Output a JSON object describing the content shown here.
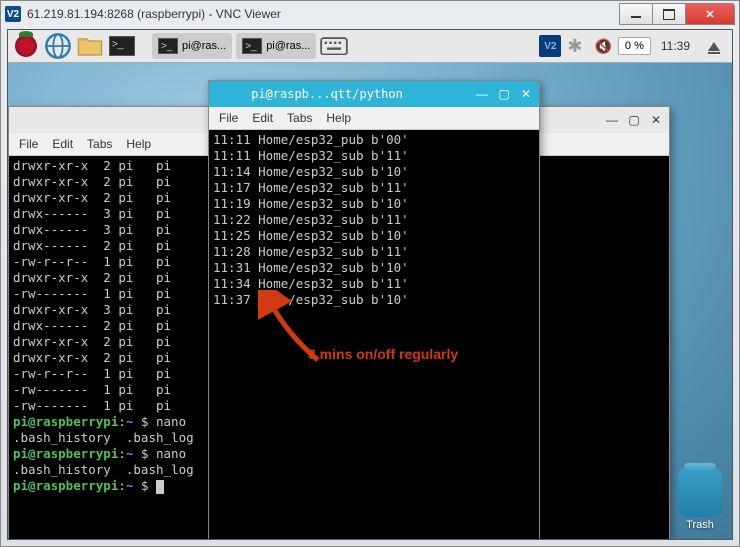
{
  "window": {
    "title": "61.219.81.194:8268 (raspberrypi) - VNC Viewer"
  },
  "taskbar": {
    "tasks": [
      {
        "label": "pi@ras..."
      },
      {
        "label": "pi@ras..."
      }
    ],
    "zoom": "0 %",
    "clock": "11:39"
  },
  "trash_label": "Trash",
  "menus": {
    "file": "File",
    "edit": "Edit",
    "tabs": "Tabs",
    "help": "Help"
  },
  "back_terminal": {
    "title": "",
    "ls_rows": [
      "drwxr-xr-x  2 pi   pi",
      "drwxr-xr-x  2 pi   pi",
      "drwxr-xr-x  2 pi   pi",
      "drwx------  3 pi   pi",
      "drwx------  3 pi   pi",
      "drwx------  2 pi   pi",
      "-rw-r--r--  1 pi   pi",
      "drwxr-xr-x  2 pi   pi",
      "-rw-------  1 pi   pi",
      "drwxr-xr-x  3 pi   pi",
      "drwx------  2 pi   pi",
      "drwxr-xr-x  2 pi   pi",
      "drwxr-xr-x  2 pi   pi",
      "-rw-r--r--  1 pi   pi",
      "-rw-------  1 pi   pi",
      "-rw-------  1 pi   pi"
    ],
    "prompt_user": "pi@raspberrypi",
    "prompt_path": "~",
    "cmd": "nano",
    "completion1": ".bash_history  .bash_log",
    "completion2": ".bash_history  .bash_log"
  },
  "front_terminal": {
    "title": "pi@raspb...qtt/python",
    "log_rows": [
      "11:11 Home/esp32_pub b'00'",
      "11:11 Home/esp32_sub b'11'",
      "11:14 Home/esp32_sub b'10'",
      "11:17 Home/esp32_sub b'11'",
      "11:19 Home/esp32_sub b'10'",
      "11:22 Home/esp32_sub b'11'",
      "11:25 Home/esp32_sub b'10'",
      "11:28 Home/esp32_sub b'11'",
      "11:31 Home/esp32_sub b'10'",
      "11:34 Home/esp32_sub b'11'",
      "11:37 Home/esp32_sub b'10'"
    ]
  },
  "annotation": "3 mins on/off regularly"
}
